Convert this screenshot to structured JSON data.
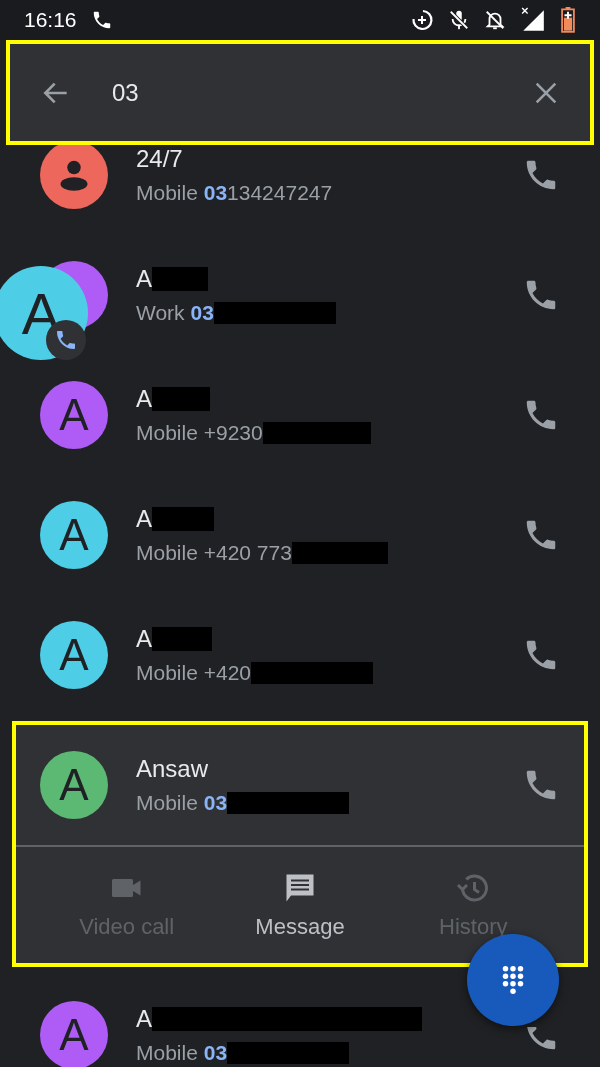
{
  "status_bar": {
    "time": "16:16"
  },
  "search": {
    "value": "03",
    "highlighted": true
  },
  "contacts": [
    {
      "name": "24/7",
      "redacted": false,
      "kind": "person",
      "color": "#ee675c",
      "phone_label": "Mobile",
      "match": "03",
      "rest": "134247247",
      "rest_redacted": false,
      "expanded": false
    },
    {
      "name": "A",
      "redacted": true,
      "kind": "letter",
      "color": "#af5cf7",
      "phone_label": "Work",
      "match": "03",
      "rest_redacted": true,
      "expanded": false
    },
    {
      "name": "A",
      "redacted": true,
      "kind": "letter",
      "letter": "A",
      "color": "#af5cf7",
      "phone_label": "Mobile",
      "rest": "+9230",
      "rest_redacted": true,
      "expanded": false
    },
    {
      "name": "A",
      "redacted": true,
      "kind": "letter",
      "letter": "A",
      "color": "#4ecde6",
      "phone_label": "Mobile",
      "rest": "+420 773",
      "rest_redacted": true,
      "expanded": false
    },
    {
      "name": "A",
      "redacted": true,
      "kind": "letter",
      "letter": "A",
      "color": "#4ecde6",
      "phone_label": "Mobile",
      "rest": "+420",
      "rest_redacted": true,
      "expanded": false
    },
    {
      "name": "Ansaw",
      "redacted": false,
      "kind": "letter",
      "letter": "A",
      "color": "#5bb974",
      "phone_label": "Mobile",
      "match": "03",
      "rest_redacted": true,
      "expanded": true,
      "highlighted": true,
      "actions": [
        {
          "kind": "video",
          "label": "Video call",
          "disabled": true
        },
        {
          "kind": "message",
          "label": "Message",
          "disabled": false
        },
        {
          "kind": "history",
          "label": "History",
          "disabled": true
        }
      ]
    },
    {
      "name": "A",
      "redacted": true,
      "kind": "letter",
      "letter": "A",
      "color": "#af5cf7",
      "phone_label": "Mobile",
      "match": "03",
      "rest_redacted": true,
      "expanded": false
    }
  ],
  "bubble": {
    "letter": "A",
    "color": "#4ecde6"
  }
}
